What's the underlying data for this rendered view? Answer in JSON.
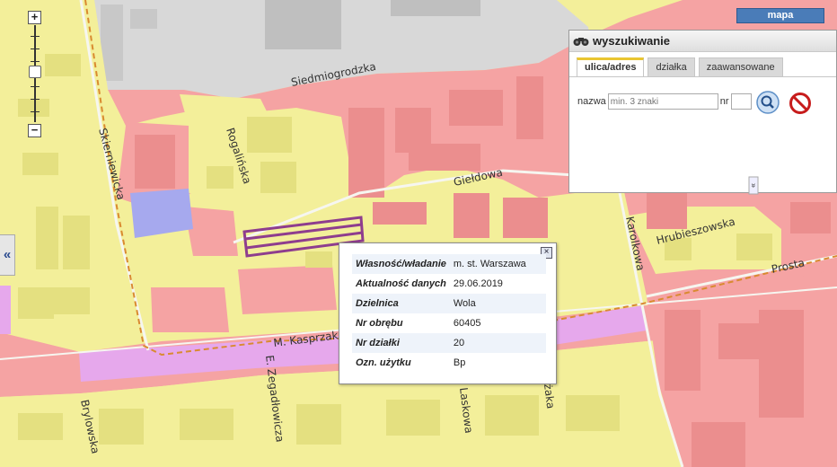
{
  "map": {
    "streets": {
      "siedmiogrodzka": "Siedmiogrodzka",
      "skierniewicka": "Skierniewicka",
      "rogalinska": "Rogalińska",
      "gieldowa": "Giełdowa",
      "karolkowa": "Karolkowa",
      "hrubieszowska": "Hrubieszowska",
      "prosta": "Prosta",
      "kasprzaka": "M. Kasprzaka",
      "zegadlowicza": "E. Zegadłowicza",
      "laskowa": "Laskowa",
      "brylowska": "Brylowska",
      "zaka": "żaka"
    },
    "colors": {
      "residential": "#f3ef9a",
      "commercial": "#f5a3a3",
      "road": "#e6c0e8",
      "parcel_outline": "#8e3d8e",
      "public": "#a6a9ee"
    }
  },
  "zoom": {
    "plus": "+",
    "minus": "−"
  },
  "side_toggle": "«",
  "map_button": "mapa",
  "search": {
    "title": "wyszukiwanie",
    "tabs": [
      "ulica/adres",
      "działka",
      "zaawansowane"
    ],
    "name_label": "nazwa",
    "name_placeholder": "min. 3 znaki",
    "nr_label": "nr",
    "nr_value": "",
    "collapse": "»"
  },
  "popup": {
    "close": "×",
    "rows": [
      {
        "key": "Własność/władanie",
        "value": "m. st. Warszawa"
      },
      {
        "key": "Aktualność danych",
        "value": "29.06.2019"
      },
      {
        "key": "Dzielnica",
        "value": "Wola"
      },
      {
        "key": "Nr obrębu",
        "value": "60405"
      },
      {
        "key": "Nr działki",
        "value": "20"
      },
      {
        "key": "Ozn. użytku",
        "value": "Bp"
      }
    ]
  }
}
